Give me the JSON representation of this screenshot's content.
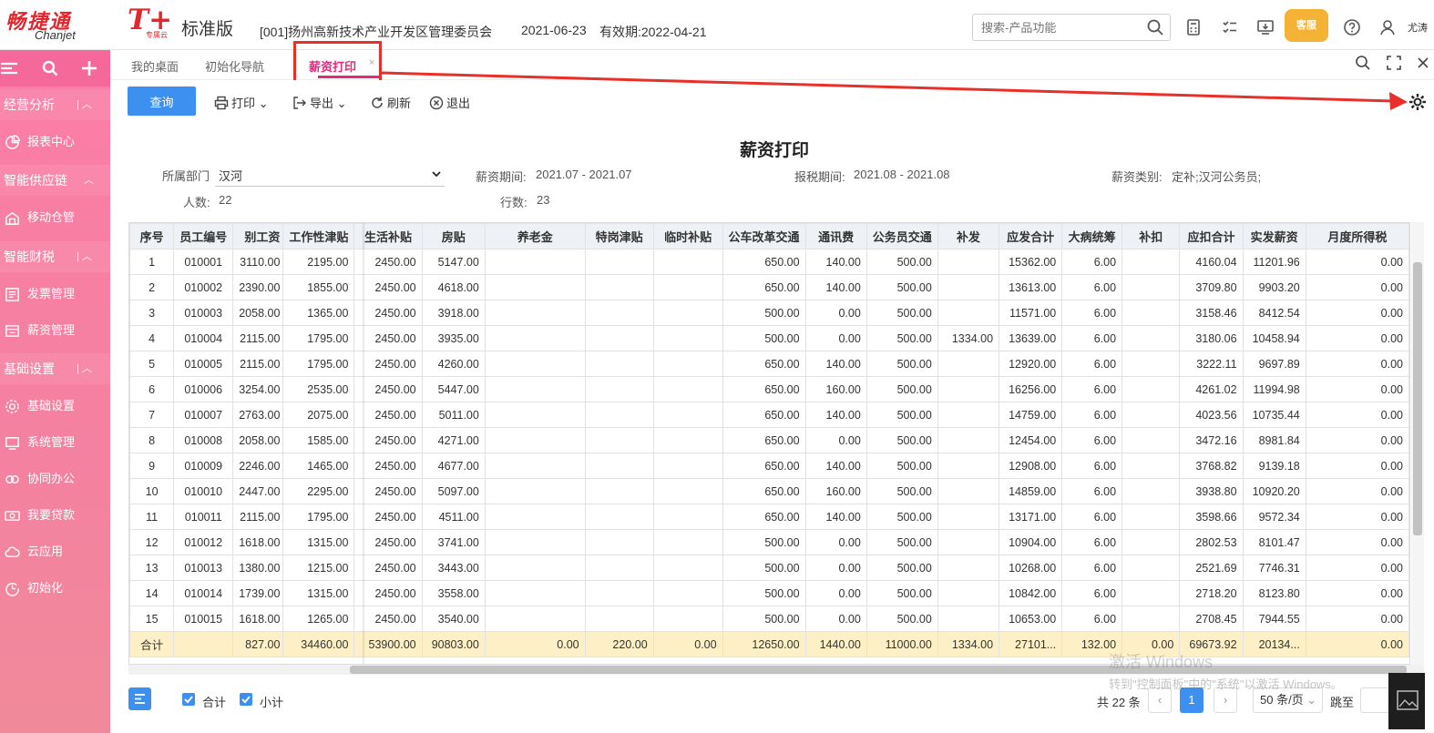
{
  "brand": {
    "name_cn": "畅捷通",
    "name_en": "Chanjet",
    "tplus": "T+",
    "tplus_sub": "专属云",
    "edition": "标准版"
  },
  "header": {
    "company": "[001]扬州高新技术产业开发区管理委员会",
    "date": "2021-06-23",
    "valid_until": "有效期:2022-04-21",
    "search_placeholder": "搜索-产品功能",
    "service_badge": "客服",
    "user": "尤涛"
  },
  "sidebar": {
    "categories": [
      {
        "label": "经营分析",
        "items": [
          {
            "label": "报表中心",
            "icon": "pie-chart-icon"
          }
        ]
      },
      {
        "label": "智能供应链",
        "items": [
          {
            "label": "移动仓管",
            "icon": "warehouse-icon"
          }
        ]
      },
      {
        "label": "智能财税",
        "items": [
          {
            "label": "发票管理",
            "icon": "invoice-icon"
          },
          {
            "label": "薪资管理",
            "icon": "salary-icon"
          }
        ]
      },
      {
        "label": "基础设置",
        "items": [
          {
            "label": "基础设置",
            "icon": "settings-icon"
          },
          {
            "label": "系统管理",
            "icon": "monitor-icon"
          },
          {
            "label": "协同办公",
            "icon": "collaboration-icon"
          },
          {
            "label": "我要贷款",
            "icon": "loan-icon"
          },
          {
            "label": "云应用",
            "icon": "cloud-icon"
          },
          {
            "label": "初始化",
            "icon": "init-icon"
          }
        ]
      }
    ]
  },
  "tabs": [
    {
      "label": "我的桌面"
    },
    {
      "label": "初始化导航"
    },
    {
      "label": "薪资打印",
      "active": true
    }
  ],
  "toolbar": {
    "query": "查询",
    "print": "打印",
    "export": "导出",
    "refresh": "刷新",
    "exit": "退出"
  },
  "report": {
    "title": "薪资打印",
    "dept_label": "所属部门",
    "dept_value": "汉河",
    "salary_period_label": "薪资期间:",
    "salary_period": "2021.07 - 2021.07",
    "tax_period_label": "报税期间:",
    "tax_period": "2021.08 - 2021.08",
    "salary_type_label": "薪资类别:",
    "salary_type": "定补;汉河公务员;",
    "headcount_label": "人数:",
    "headcount": "22",
    "rows_label": "行数:",
    "rows_count": "23"
  },
  "table": {
    "columns": [
      "序号",
      "员工编号",
      "别工资",
      "工作性津贴",
      "生活补贴",
      "房贴",
      "养老金",
      "特岗津贴",
      "临时补贴",
      "公车改革交通",
      "通讯费",
      "公务员交通",
      "补发",
      "应发合计",
      "大病统筹",
      "补扣",
      "应扣合计",
      "实发薪资",
      "月度所得税"
    ],
    "rows": [
      [
        "1",
        "010001",
        "3110.00",
        "2195.00",
        "2450.00",
        "5147.00",
        "",
        "",
        "",
        "650.00",
        "140.00",
        "500.00",
        "",
        "15362.00",
        "6.00",
        "",
        "4160.04",
        "11201.96",
        "0.00"
      ],
      [
        "2",
        "010002",
        "2390.00",
        "1855.00",
        "2450.00",
        "4618.00",
        "",
        "",
        "",
        "650.00",
        "140.00",
        "500.00",
        "",
        "13613.00",
        "6.00",
        "",
        "3709.80",
        "9903.20",
        "0.00"
      ],
      [
        "3",
        "010003",
        "2058.00",
        "1365.00",
        "2450.00",
        "3918.00",
        "",
        "",
        "",
        "500.00",
        "0.00",
        "500.00",
        "",
        "11571.00",
        "6.00",
        "",
        "3158.46",
        "8412.54",
        "0.00"
      ],
      [
        "4",
        "010004",
        "2115.00",
        "1795.00",
        "2450.00",
        "3935.00",
        "",
        "",
        "",
        "500.00",
        "0.00",
        "500.00",
        "1334.00",
        "13639.00",
        "6.00",
        "",
        "3180.06",
        "10458.94",
        "0.00"
      ],
      [
        "5",
        "010005",
        "2115.00",
        "1795.00",
        "2450.00",
        "4260.00",
        "",
        "",
        "",
        "650.00",
        "140.00",
        "500.00",
        "",
        "12920.00",
        "6.00",
        "",
        "3222.11",
        "9697.89",
        "0.00"
      ],
      [
        "6",
        "010006",
        "3254.00",
        "2535.00",
        "2450.00",
        "5447.00",
        "",
        "",
        "",
        "650.00",
        "160.00",
        "500.00",
        "",
        "16256.00",
        "6.00",
        "",
        "4261.02",
        "11994.98",
        "0.00"
      ],
      [
        "7",
        "010007",
        "2763.00",
        "2075.00",
        "2450.00",
        "5011.00",
        "",
        "",
        "",
        "650.00",
        "140.00",
        "500.00",
        "",
        "14759.00",
        "6.00",
        "",
        "4023.56",
        "10735.44",
        "0.00"
      ],
      [
        "8",
        "010008",
        "2058.00",
        "1585.00",
        "2450.00",
        "4271.00",
        "",
        "",
        "",
        "650.00",
        "0.00",
        "500.00",
        "",
        "12454.00",
        "6.00",
        "",
        "3472.16",
        "8981.84",
        "0.00"
      ],
      [
        "9",
        "010009",
        "2246.00",
        "1465.00",
        "2450.00",
        "4677.00",
        "",
        "",
        "",
        "650.00",
        "140.00",
        "500.00",
        "",
        "12908.00",
        "6.00",
        "",
        "3768.82",
        "9139.18",
        "0.00"
      ],
      [
        "10",
        "010010",
        "2447.00",
        "2295.00",
        "2450.00",
        "5097.00",
        "",
        "",
        "",
        "650.00",
        "160.00",
        "500.00",
        "",
        "14859.00",
        "6.00",
        "",
        "3938.80",
        "10920.20",
        "0.00"
      ],
      [
        "11",
        "010011",
        "2115.00",
        "1795.00",
        "2450.00",
        "4511.00",
        "",
        "",
        "",
        "650.00",
        "140.00",
        "500.00",
        "",
        "13171.00",
        "6.00",
        "",
        "3598.66",
        "9572.34",
        "0.00"
      ],
      [
        "12",
        "010012",
        "1618.00",
        "1315.00",
        "2450.00",
        "3741.00",
        "",
        "",
        "",
        "500.00",
        "0.00",
        "500.00",
        "",
        "10904.00",
        "6.00",
        "",
        "2802.53",
        "8101.47",
        "0.00"
      ],
      [
        "13",
        "010013",
        "1380.00",
        "1215.00",
        "2450.00",
        "3443.00",
        "",
        "",
        "",
        "500.00",
        "0.00",
        "500.00",
        "",
        "10268.00",
        "6.00",
        "",
        "2521.69",
        "7746.31",
        "0.00"
      ],
      [
        "14",
        "010014",
        "1739.00",
        "1315.00",
        "2450.00",
        "3558.00",
        "",
        "",
        "",
        "500.00",
        "0.00",
        "500.00",
        "",
        "10842.00",
        "6.00",
        "",
        "2718.20",
        "8123.80",
        "0.00"
      ],
      [
        "15",
        "010015",
        "1618.00",
        "1265.00",
        "2450.00",
        "3540.00",
        "",
        "",
        "",
        "500.00",
        "0.00",
        "500.00",
        "",
        "10653.00",
        "6.00",
        "",
        "2708.45",
        "7944.55",
        "0.00"
      ]
    ],
    "total": [
      "合计",
      "",
      "827.00",
      "34460.00",
      "53900.00",
      "90803.00",
      "0.00",
      "220.00",
      "0.00",
      "12650.00",
      "1440.00",
      "11000.00",
      "1334.00",
      "27101...",
      "132.00",
      "0.00",
      "69673.92",
      "20134...",
      "0.00"
    ]
  },
  "footer": {
    "sum_label": "合计",
    "subtotal_label": "小计",
    "total_records": "共 22 条",
    "current_page": "1",
    "page_size": "50 条/页",
    "jump_label": "跳至"
  },
  "watermark": {
    "line1": "激活 Windows",
    "line2": "转到\"控制面板\"中的\"系统\"以激活 Windows。"
  },
  "colors": {
    "brand_red": "#e3262e",
    "sidebar_pink": "#f77aa5",
    "accent_blue": "#3d8ff0",
    "active_tab": "#e5287a",
    "total_row": "#fdf0c6"
  }
}
